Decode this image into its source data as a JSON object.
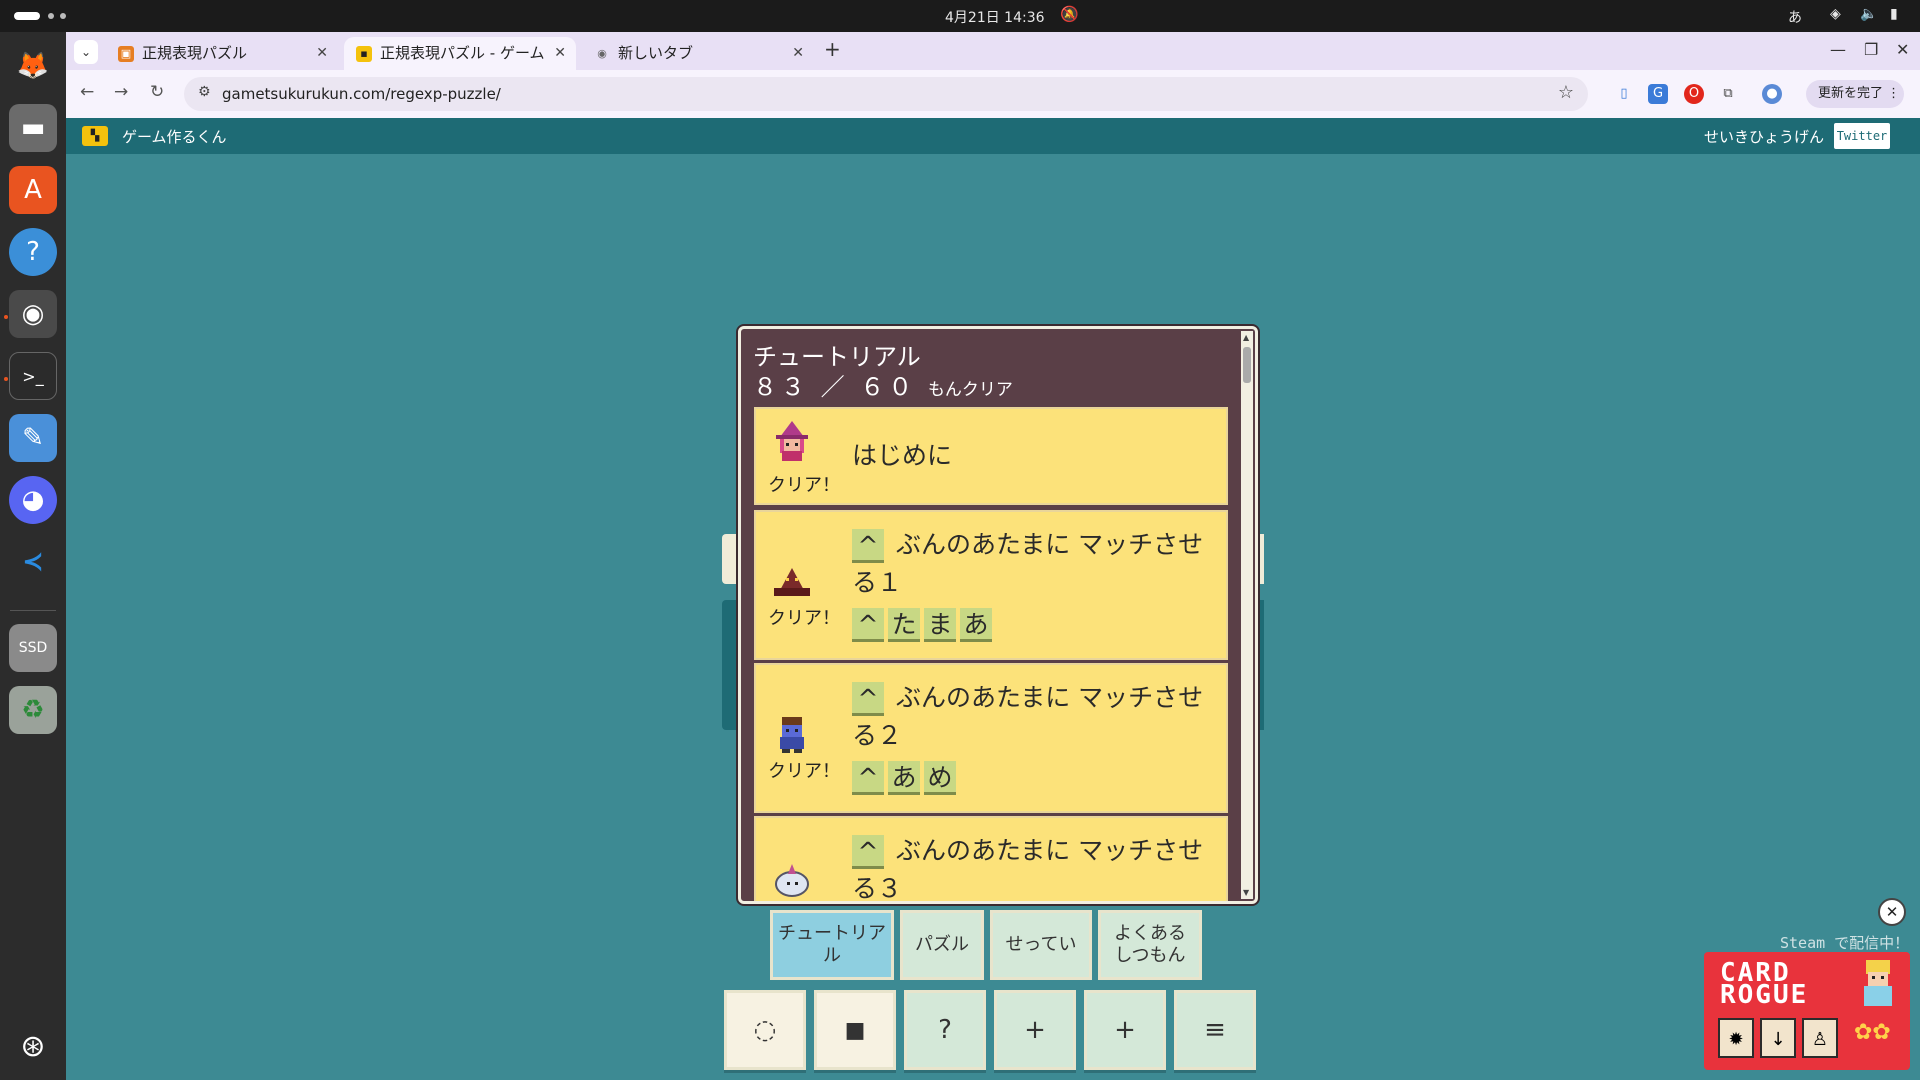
{
  "system": {
    "clock": "4月21日  14:36",
    "ime": "あ"
  },
  "browser": {
    "tabs": [
      {
        "label": "正規表現パズル",
        "active": false
      },
      {
        "label": "正規表現パズル - ゲーム",
        "active": true
      },
      {
        "label": "新しいタブ",
        "active": false
      }
    ],
    "url": "gametsukurukun.com/regexp-puzzle/",
    "update_label": "更新を完了"
  },
  "site": {
    "name": "ゲーム作るくん",
    "right_text": "せいきひょうげん",
    "twitter_label": "Twitter"
  },
  "panel": {
    "title": "チュートリアル",
    "progress": "８３ ／ ６０",
    "progress_suffix": "もんクリア",
    "cards": [
      {
        "title": "はじめに",
        "status": "クリア！",
        "chips": []
      },
      {
        "title_line1": "ぶんのあたまに マッチさせ",
        "title_line2": "る１",
        "status": "クリア！",
        "head_chip": "^",
        "chips": [
          "^",
          "た",
          "ま",
          "あ"
        ]
      },
      {
        "title_line1": "ぶんのあたまに マッチさせ",
        "title_line2": "る２",
        "status": "クリア！",
        "head_chip": "^",
        "chips": [
          "^",
          "あ",
          "め"
        ]
      },
      {
        "title_line1": "ぶんのあたまに マッチさせ",
        "title_line2": "る３",
        "status": "",
        "head_chip": "^",
        "chips": []
      }
    ]
  },
  "game_tabs": [
    {
      "label": "チュートリアル",
      "active": true
    },
    {
      "label": "パズル",
      "active": false
    },
    {
      "label": "せってい",
      "active": false
    },
    {
      "label_line1": "よくある",
      "label_line2": "しつもん",
      "active": false
    }
  ],
  "game_buttons": [
    {
      "icon": "dotted-circle-icon",
      "glyph": "◌"
    },
    {
      "icon": "lock-icon",
      "glyph": "🔒"
    },
    {
      "icon": "question-icon",
      "glyph": "?"
    },
    {
      "icon": "plus-icon",
      "glyph": "+"
    },
    {
      "icon": "plus-icon",
      "glyph": "+"
    },
    {
      "icon": "menu-icon",
      "glyph": "≡"
    }
  ],
  "ad": {
    "caption": "Steam で配信中！",
    "logo_line1": "CARD",
    "logo_line2": "ROGUE"
  },
  "colors": {
    "page_bg": "#3d8a93",
    "header_bg": "#1e6b75",
    "card_bg": "#fce27a",
    "panel_bg": "#5a3f47",
    "active_tab": "#8ecfe0"
  }
}
